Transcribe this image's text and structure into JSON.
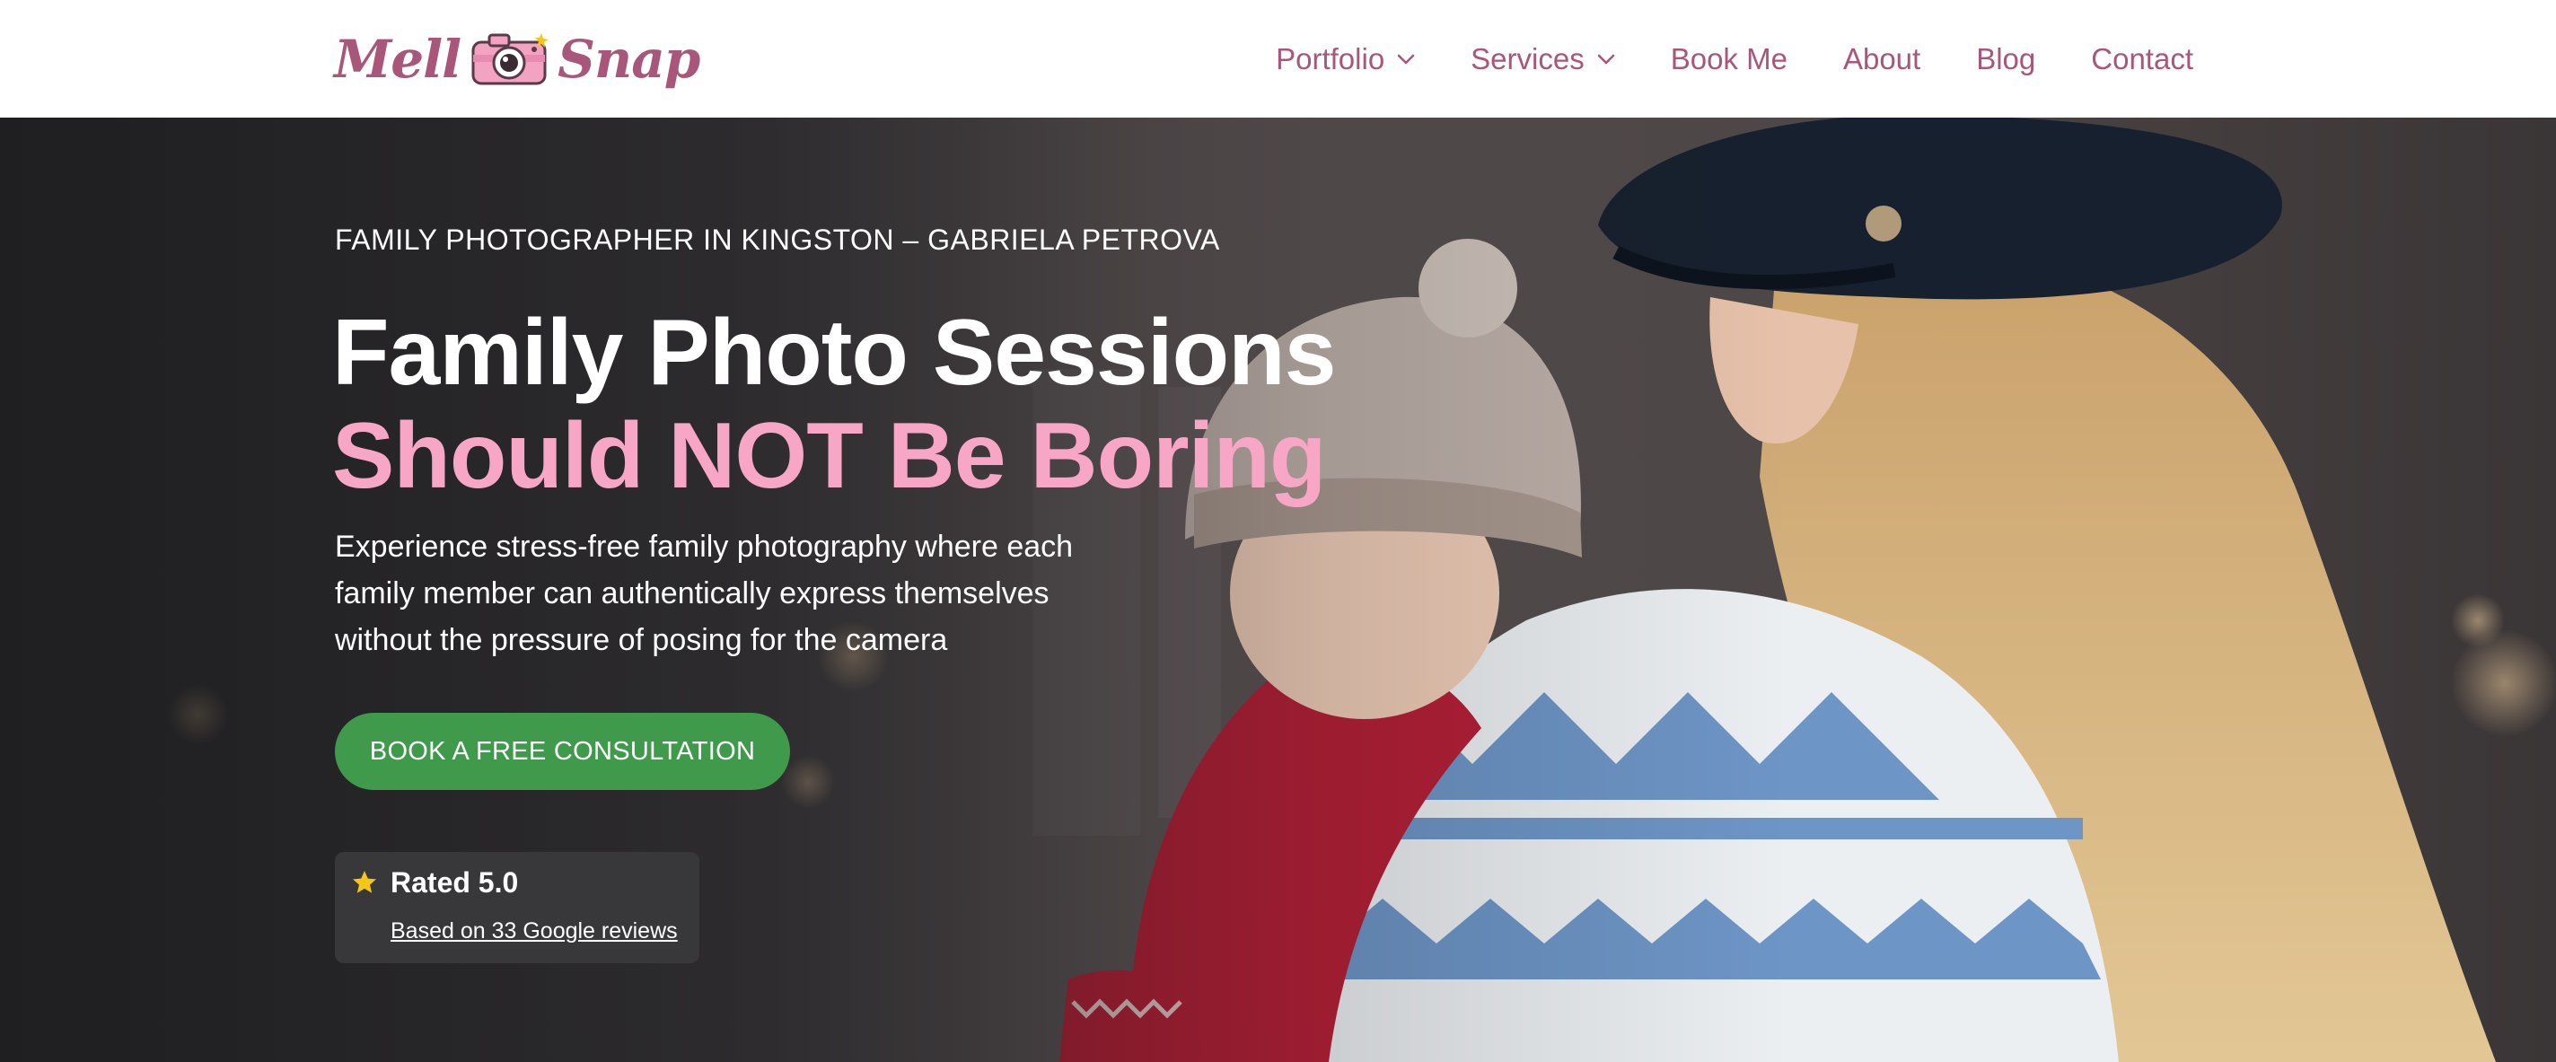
{
  "brand": {
    "logo_word_1": "Mell",
    "logo_word_2": "Snap",
    "logo_icon": "camera-icon",
    "color": "#a8577a"
  },
  "nav": {
    "items": [
      {
        "label": "Portfolio",
        "has_dropdown": true
      },
      {
        "label": "Services",
        "has_dropdown": true
      },
      {
        "label": "Book Me",
        "has_dropdown": false
      },
      {
        "label": "About",
        "has_dropdown": false
      },
      {
        "label": "Blog",
        "has_dropdown": false
      },
      {
        "label": "Contact",
        "has_dropdown": false
      }
    ]
  },
  "hero": {
    "eyebrow": "FAMILY PHOTOGRAPHER IN KINGSTON – GABRIELA PETROVA",
    "title_line_1": "Family Photo Sessions",
    "title_line_2": "Should NOT Be Boring",
    "subtitle": "Experience stress-free family photography where each family member can authentically express themselves without the pressure of posing for the camera",
    "cta_label": "BOOK A FREE CONSULTATION",
    "rating": {
      "title": "Rated 5.0",
      "link": "Based on 33 Google reviews",
      "icon": "star-icon"
    }
  },
  "colors": {
    "accent_pink": "#f7a6c6",
    "cta_green": "#3f9a4c",
    "star_yellow": "#f5c518"
  }
}
